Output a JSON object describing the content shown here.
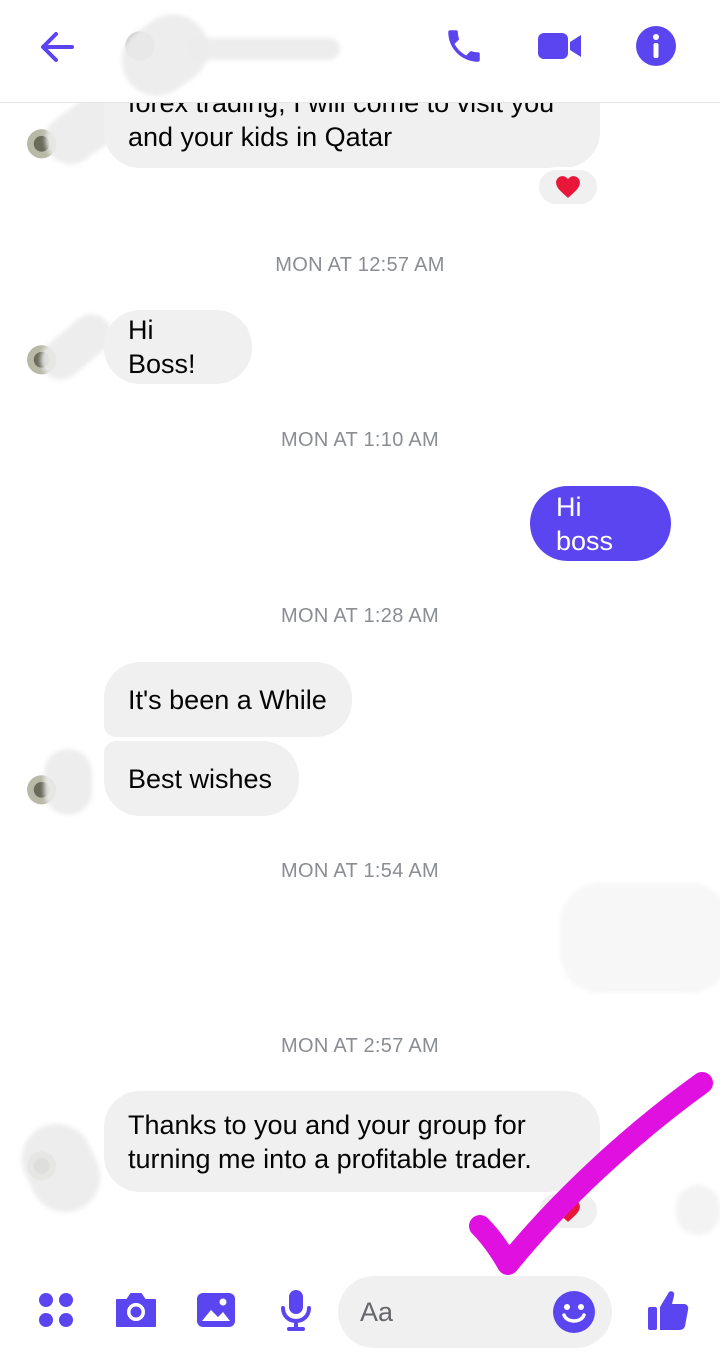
{
  "header": {
    "back_icon": "arrow-left-icon",
    "call_icon": "phone-icon",
    "video_icon": "video-camera-icon",
    "info_icon": "info-icon",
    "accent": "#5b45f0"
  },
  "messages": [
    {
      "type": "incoming",
      "lines": [
        "forex trading, I will come to visit you",
        "and your kids in Qatar"
      ],
      "reaction": "heart"
    },
    {
      "type": "timestamp",
      "text": "MON AT 12:57 AM"
    },
    {
      "type": "incoming",
      "lines": [
        "Hi Boss!"
      ]
    },
    {
      "type": "timestamp",
      "text": "MON AT 1:10 AM"
    },
    {
      "type": "outgoing",
      "lines": [
        "Hi boss"
      ]
    },
    {
      "type": "timestamp",
      "text": "MON AT 1:28 AM"
    },
    {
      "type": "incoming",
      "lines": [
        "It's been a While"
      ]
    },
    {
      "type": "incoming",
      "lines": [
        "Best wishes"
      ]
    },
    {
      "type": "timestamp",
      "text": "MON AT 1:54 AM"
    },
    {
      "type": "timestamp",
      "text": "MON AT 2:57 AM"
    },
    {
      "type": "incoming",
      "lines": [
        "Thanks to you and your group for",
        "turning me into a profitable trader."
      ],
      "reaction": "heart"
    }
  ],
  "composer": {
    "placeholder": "Aa",
    "icons": [
      "menu-dots-icon",
      "camera-icon",
      "gallery-icon",
      "microphone-icon",
      "emoji-icon",
      "thumbs-up-icon"
    ]
  },
  "colors": {
    "incoming_bubble": "#f0f0f0",
    "outgoing_bubble": "#5b45f0",
    "timestamp": "#8a8d91",
    "annotation_checkmark": "#e011e0",
    "heart": "#e8173a"
  }
}
